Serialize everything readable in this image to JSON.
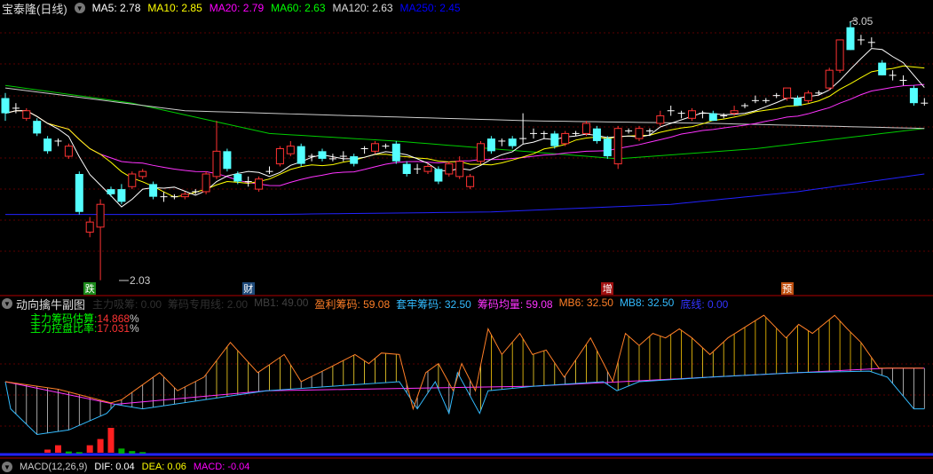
{
  "header": {
    "title": "宝泰隆(日线)",
    "ma": [
      {
        "label": "MA5: 2.78",
        "color": "#ffffff"
      },
      {
        "label": "MA10: 2.85",
        "color": "#ffff00"
      },
      {
        "label": "MA20: 2.79",
        "color": "#ff00ff"
      },
      {
        "label": "MA60: 2.63",
        "color": "#00ff00"
      },
      {
        "label": "MA120: 2.63",
        "color": "#dddddd"
      },
      {
        "label": "MA250: 2.45",
        "color": "#0000ff"
      }
    ]
  },
  "annotations": {
    "high": "3.05",
    "low": "2.03"
  },
  "markers": [
    {
      "text": "跌",
      "bar": 8,
      "color": "#1a8a1a"
    },
    {
      "text": "财",
      "bar": 23,
      "color": "#1e4a7a"
    },
    {
      "text": "增",
      "bar": 57,
      "color": "#a01010"
    },
    {
      "text": "预",
      "bar": 74,
      "color": "#c05010"
    }
  ],
  "sub_header": {
    "title": "动向擒牛副图",
    "items": [
      {
        "label": "主力吸筹: 0.00",
        "color": "#303030"
      },
      {
        "label": "筹码专用线: 2.00",
        "color": "#303030"
      },
      {
        "label": "MB1: 49.00",
        "color": "#404040"
      },
      {
        "label": "盈利筹码: 59.08",
        "color": "#ff7f27"
      },
      {
        "label": "套牢筹码: 32.50",
        "color": "#33bbff"
      },
      {
        "label": "筹码均量: 59.08",
        "color": "#ff33ff"
      },
      {
        "label": "MB6: 32.50",
        "color": "#ff7f27"
      },
      {
        "label": "MB8: 32.50",
        "color": "#33bbff"
      },
      {
        "label": "底线: 0.00",
        "color": "#3333ff"
      }
    ]
  },
  "sub_notes": [
    {
      "label": "主力筹码估算:",
      "value": "14.868",
      "unit": "%"
    },
    {
      "label": "主力控盘比率:",
      "value": "17.031",
      "unit": "%"
    }
  ],
  "macd_header": {
    "title": "MACD(12,26,9)",
    "dif": "DIF: 0.04",
    "dea": "DEA: 0.06",
    "macd": "MACD: -0.04"
  },
  "chart_data": [
    {
      "type": "candlestick",
      "title": "宝泰隆(日线)",
      "ylim": [
        2.03,
        3.05
      ],
      "ohlc": [
        [
          2.75,
          2.77,
          2.66,
          2.69
        ],
        [
          2.71,
          2.73,
          2.69,
          2.71
        ],
        [
          2.67,
          2.71,
          2.66,
          2.7
        ],
        [
          2.66,
          2.67,
          2.6,
          2.61
        ],
        [
          2.59,
          2.6,
          2.53,
          2.54
        ],
        [
          2.58,
          2.59,
          2.56,
          2.58
        ],
        [
          2.52,
          2.57,
          2.51,
          2.56
        ],
        [
          2.45,
          2.46,
          2.29,
          2.3
        ],
        [
          2.22,
          2.28,
          2.2,
          2.26
        ],
        [
          2.24,
          2.35,
          2.03,
          2.33
        ],
        [
          2.39,
          2.4,
          2.36,
          2.37
        ],
        [
          2.39,
          2.41,
          2.33,
          2.34
        ],
        [
          2.4,
          2.46,
          2.39,
          2.45
        ],
        [
          2.44,
          2.47,
          2.43,
          2.46
        ],
        [
          2.41,
          2.42,
          2.35,
          2.36
        ],
        [
          2.36,
          2.38,
          2.34,
          2.36
        ],
        [
          2.36,
          2.37,
          2.35,
          2.36
        ],
        [
          2.36,
          2.38,
          2.35,
          2.37
        ],
        [
          2.38,
          2.39,
          2.37,
          2.38
        ],
        [
          2.38,
          2.46,
          2.37,
          2.45
        ],
        [
          2.44,
          2.66,
          2.43,
          2.54
        ],
        [
          2.54,
          2.55,
          2.46,
          2.47
        ],
        [
          2.45,
          2.46,
          2.41,
          2.42
        ],
        [
          2.42,
          2.44,
          2.4,
          2.42
        ],
        [
          2.39,
          2.44,
          2.38,
          2.43
        ],
        [
          2.46,
          2.48,
          2.45,
          2.46
        ],
        [
          2.49,
          2.56,
          2.48,
          2.55
        ],
        [
          2.53,
          2.58,
          2.52,
          2.56
        ],
        [
          2.56,
          2.57,
          2.48,
          2.49
        ],
        [
          2.52,
          2.53,
          2.5,
          2.52
        ],
        [
          2.54,
          2.55,
          2.5,
          2.51
        ],
        [
          2.51,
          2.53,
          2.5,
          2.51
        ],
        [
          2.52,
          2.54,
          2.5,
          2.52
        ],
        [
          2.52,
          2.53,
          2.48,
          2.49
        ],
        [
          2.55,
          2.56,
          2.53,
          2.55
        ],
        [
          2.54,
          2.58,
          2.53,
          2.57
        ],
        [
          2.56,
          2.57,
          2.55,
          2.56
        ],
        [
          2.57,
          2.58,
          2.49,
          2.5
        ],
        [
          2.49,
          2.5,
          2.44,
          2.45
        ],
        [
          2.47,
          2.49,
          2.45,
          2.47
        ],
        [
          2.46,
          2.49,
          2.45,
          2.48
        ],
        [
          2.47,
          2.48,
          2.41,
          2.42
        ],
        [
          2.45,
          2.5,
          2.44,
          2.49
        ],
        [
          2.44,
          2.52,
          2.43,
          2.5
        ],
        [
          2.4,
          2.45,
          2.39,
          2.44
        ],
        [
          2.5,
          2.58,
          2.49,
          2.57
        ],
        [
          2.59,
          2.6,
          2.53,
          2.54
        ],
        [
          2.58,
          2.59,
          2.56,
          2.58
        ],
        [
          2.59,
          2.6,
          2.55,
          2.56
        ],
        [
          2.59,
          2.69,
          2.57,
          2.59
        ],
        [
          2.61,
          2.63,
          2.59,
          2.61
        ],
        [
          2.61,
          2.62,
          2.59,
          2.61
        ],
        [
          2.61,
          2.62,
          2.55,
          2.56
        ],
        [
          2.57,
          2.62,
          2.56,
          2.61
        ],
        [
          2.61,
          2.62,
          2.6,
          2.61
        ],
        [
          2.61,
          2.66,
          2.6,
          2.65
        ],
        [
          2.63,
          2.64,
          2.57,
          2.58
        ],
        [
          2.59,
          2.6,
          2.51,
          2.52
        ],
        [
          2.49,
          2.64,
          2.47,
          2.63
        ],
        [
          2.62,
          2.63,
          2.61,
          2.62
        ],
        [
          2.59,
          2.64,
          2.58,
          2.63
        ],
        [
          2.62,
          2.63,
          2.6,
          2.62
        ],
        [
          2.65,
          2.7,
          2.64,
          2.68
        ],
        [
          2.7,
          2.72,
          2.68,
          2.7
        ],
        [
          2.69,
          2.7,
          2.67,
          2.69
        ],
        [
          2.67,
          2.71,
          2.66,
          2.7
        ],
        [
          2.69,
          2.7,
          2.67,
          2.69
        ],
        [
          2.69,
          2.7,
          2.66,
          2.66
        ],
        [
          2.68,
          2.69,
          2.67,
          2.68
        ],
        [
          2.69,
          2.72,
          2.68,
          2.7
        ],
        [
          2.72,
          2.73,
          2.71,
          2.72
        ],
        [
          2.74,
          2.76,
          2.73,
          2.74
        ],
        [
          2.74,
          2.75,
          2.73,
          2.74
        ],
        [
          2.76,
          2.77,
          2.75,
          2.76
        ],
        [
          2.75,
          2.79,
          2.74,
          2.79
        ],
        [
          2.75,
          2.76,
          2.72,
          2.72
        ],
        [
          2.74,
          2.78,
          2.73,
          2.77
        ],
        [
          2.77,
          2.78,
          2.76,
          2.77
        ],
        [
          2.79,
          2.87,
          2.78,
          2.86
        ],
        [
          2.86,
          2.98,
          2.85,
          2.98
        ],
        [
          3.03,
          3.05,
          2.94,
          2.94
        ],
        [
          2.98,
          3.0,
          2.96,
          2.98
        ],
        [
          2.97,
          2.99,
          2.95,
          2.97
        ],
        [
          2.89,
          2.9,
          2.84,
          2.84
        ],
        [
          2.84,
          2.86,
          2.82,
          2.84
        ],
        [
          2.82,
          2.84,
          2.8,
          2.82
        ],
        [
          2.79,
          2.8,
          2.72,
          2.73
        ],
        [
          2.73,
          2.75,
          2.72,
          2.73
        ]
      ],
      "ma_long": {
        "MA60": [
          [
            0,
            2.8
          ],
          [
            12,
            2.73
          ],
          [
            25,
            2.61
          ],
          [
            37,
            2.58
          ],
          [
            58,
            2.51
          ],
          [
            71,
            2.55
          ],
          [
            87,
            2.63
          ]
        ],
        "MA120": [
          [
            0,
            2.79
          ],
          [
            17,
            2.7
          ],
          [
            33,
            2.68
          ],
          [
            50,
            2.66
          ],
          [
            67,
            2.65
          ],
          [
            87,
            2.63
          ]
        ],
        "MA250": [
          [
            0,
            2.29
          ],
          [
            25,
            2.29
          ],
          [
            46,
            2.3
          ],
          [
            63,
            2.33
          ],
          [
            75,
            2.38
          ],
          [
            87,
            2.45
          ]
        ]
      }
    },
    {
      "type": "line",
      "title": "动向擒牛副图",
      "ylim": [
        0,
        100
      ],
      "series": [
        {
          "name": "盈利筹码",
          "color": "#ff7f27",
          "points": [
            [
              0,
              50
            ],
            [
              5,
              45
            ],
            [
              10,
              36
            ],
            [
              11,
              38
            ],
            [
              14.6,
              56
            ],
            [
              16.3,
              44
            ],
            [
              18.8,
              53
            ],
            [
              21.3,
              76
            ],
            [
              23.9,
              56
            ],
            [
              26.4,
              68
            ],
            [
              28,
              50
            ],
            [
              30.6,
              59
            ],
            [
              33.1,
              68
            ],
            [
              34.4,
              62
            ],
            [
              35.6,
              69
            ],
            [
              37.3,
              68
            ],
            [
              38.6,
              32
            ],
            [
              39.8,
              56
            ],
            [
              41,
              62
            ],
            [
              42.4,
              44
            ],
            [
              43.2,
              62
            ],
            [
              44.5,
              44
            ],
            [
              45.7,
              85
            ],
            [
              47,
              68
            ],
            [
              48.7,
              82
            ],
            [
              49.9,
              68
            ],
            [
              51.2,
              71
            ],
            [
              52.9,
              53
            ],
            [
              55.4,
              79
            ],
            [
              57.5,
              50
            ],
            [
              58.7,
              82
            ],
            [
              60,
              74
            ],
            [
              61.3,
              82
            ],
            [
              62.5,
              79
            ],
            [
              63.8,
              85
            ],
            [
              65,
              79
            ],
            [
              66.7,
              68
            ],
            [
              68.4,
              79
            ],
            [
              71.8,
              94
            ],
            [
              73.9,
              79
            ],
            [
              75.1,
              88
            ],
            [
              76.4,
              82
            ],
            [
              78.5,
              94
            ],
            [
              79.7,
              85
            ],
            [
              81,
              76
            ],
            [
              82.7,
              59
            ],
            [
              84.8,
              59
            ],
            [
              86.9,
              59
            ]
          ]
        },
        {
          "name": "套牢筹码",
          "color": "#33bbff",
          "points": [
            [
              0,
              50
            ],
            [
              0.5,
              32
            ],
            [
              3,
              15
            ],
            [
              6,
              18
            ],
            [
              9.6,
              29
            ],
            [
              10.4,
              35
            ],
            [
              13,
              32
            ],
            [
              24.7,
              44
            ],
            [
              37.3,
              50
            ],
            [
              39,
              32
            ],
            [
              40.7,
              50
            ],
            [
              42,
              29
            ],
            [
              42.8,
              56
            ],
            [
              44.9,
              29
            ],
            [
              45.7,
              44
            ],
            [
              50,
              47
            ],
            [
              56.6,
              50
            ],
            [
              57.9,
              44
            ],
            [
              60,
              50
            ],
            [
              66.7,
              53
            ],
            [
              75,
              56
            ],
            [
              81.8,
              57
            ],
            [
              83.5,
              53
            ],
            [
              86,
              32
            ],
            [
              87,
              32
            ]
          ]
        },
        {
          "name": "筹码均量",
          "color": "#ff33ff",
          "points": [
            [
              0,
              50
            ],
            [
              10.4,
              35
            ],
            [
              24.7,
              44
            ],
            [
              50,
              47
            ],
            [
              66.7,
              53
            ],
            [
              83.5,
              59
            ],
            [
              87,
              59
            ]
          ]
        }
      ],
      "macd_bars": [
        [
          4,
          0.005
        ],
        [
          5,
          0.012
        ],
        [
          6,
          -0.006
        ],
        [
          7,
          -0.003
        ],
        [
          8,
          0.012
        ],
        [
          9,
          0.022
        ],
        [
          10,
          0.04
        ],
        [
          11,
          -0.02
        ],
        [
          12,
          -0.008
        ],
        [
          13,
          -0.003
        ]
      ]
    }
  ]
}
